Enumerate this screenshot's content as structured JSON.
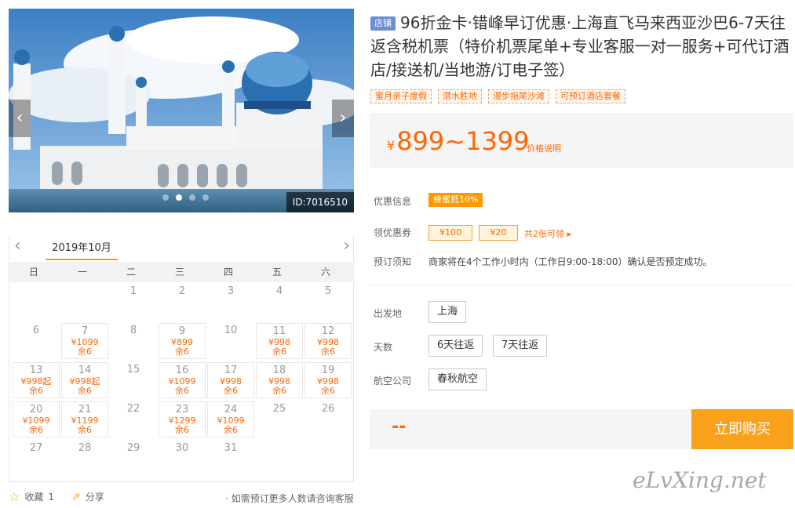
{
  "photo": {
    "id_label": "ID:7016510",
    "prev_icon": "chevron-left-icon",
    "next_icon": "chevron-right-icon",
    "dots": 4,
    "active_dot": 1
  },
  "calendar": {
    "month": "2019年10月",
    "prev": "‹",
    "next": "›",
    "weekdays": [
      "日",
      "一",
      "二",
      "三",
      "四",
      "五",
      "六"
    ],
    "days": [
      {
        "day": "1",
        "col": 2,
        "row": 0
      },
      {
        "day": "2",
        "col": 3,
        "row": 0
      },
      {
        "day": "3",
        "col": 4,
        "row": 0
      },
      {
        "day": "4",
        "col": 5,
        "row": 0
      },
      {
        "day": "5",
        "col": 6,
        "row": 0
      },
      {
        "day": "6",
        "col": 0,
        "row": 1
      },
      {
        "day": "7",
        "col": 1,
        "row": 1,
        "price": "¥1099",
        "rest": "余6"
      },
      {
        "day": "8",
        "col": 2,
        "row": 1
      },
      {
        "day": "9",
        "col": 3,
        "row": 1,
        "price": "¥899",
        "rest": "余6"
      },
      {
        "day": "10",
        "col": 4,
        "row": 1
      },
      {
        "day": "11",
        "col": 5,
        "row": 1,
        "price": "¥998",
        "rest": "余6"
      },
      {
        "day": "12",
        "col": 6,
        "row": 1,
        "price": "¥998",
        "rest": "余6"
      },
      {
        "day": "13",
        "col": 0,
        "row": 2,
        "price": "¥998起",
        "rest": "余6"
      },
      {
        "day": "14",
        "col": 1,
        "row": 2,
        "price": "¥998起",
        "rest": "余6"
      },
      {
        "day": "15",
        "col": 2,
        "row": 2
      },
      {
        "day": "16",
        "col": 3,
        "row": 2,
        "price": "¥1099",
        "rest": "余6"
      },
      {
        "day": "17",
        "col": 4,
        "row": 2,
        "price": "¥998",
        "rest": "余6"
      },
      {
        "day": "18",
        "col": 5,
        "row": 2,
        "price": "¥998",
        "rest": "余6"
      },
      {
        "day": "19",
        "col": 6,
        "row": 2,
        "price": "¥998",
        "rest": "余6"
      },
      {
        "day": "20",
        "col": 0,
        "row": 3,
        "price": "¥1099",
        "rest": "余6"
      },
      {
        "day": "21",
        "col": 1,
        "row": 3,
        "price": "¥1199",
        "rest": "余6"
      },
      {
        "day": "22",
        "col": 2,
        "row": 3
      },
      {
        "day": "23",
        "col": 3,
        "row": 3,
        "price": "¥1299",
        "rest": "余6"
      },
      {
        "day": "24",
        "col": 4,
        "row": 3,
        "price": "¥1099",
        "rest": "余6"
      },
      {
        "day": "25",
        "col": 5,
        "row": 3
      },
      {
        "day": "26",
        "col": 6,
        "row": 3
      },
      {
        "day": "27",
        "col": 0,
        "row": 4
      },
      {
        "day": "28",
        "col": 1,
        "row": 4
      },
      {
        "day": "29",
        "col": 2,
        "row": 4
      },
      {
        "day": "30",
        "col": 3,
        "row": 4
      },
      {
        "day": "31",
        "col": 4,
        "row": 4
      }
    ]
  },
  "footer": {
    "fav_label": "收藏",
    "fav_count": "1",
    "share_label": "分享",
    "note": "· 如需预订更多人数请咨询客服"
  },
  "product": {
    "shop_badge": "店铺",
    "title": "96折金卡·错峰早订优惠·上海直飞马来西亚沙巴6-7天往返含税机票（特价机票尾单+专业客服一对一服务+可代订酒店/接送机/当地游/订电子签）",
    "tags": [
      "蜜月亲子度假",
      "潜水胜地",
      "漫步拖尾沙滩",
      "可预订酒店套餐"
    ],
    "price_currency": "¥",
    "price_range": "899~1399",
    "price_note": "价格说明"
  },
  "info": {
    "discount_label": "优惠信息",
    "discount_value": "蜂蜜抵10%",
    "coupon_label": "领优惠券",
    "coupons": [
      "¥100",
      "¥20"
    ],
    "coupon_more": "共2张可领 ▸",
    "notice_label": "预订须知",
    "notice_text": "商家将在4个工作小时内（工作日9:00-18:00）确认是否预定成功。"
  },
  "options": {
    "departure_label": "出发地",
    "departure": "上海",
    "days_label": "天数",
    "days": [
      "6天往返",
      "7天往返"
    ],
    "airline_label": "航空公司",
    "airline": "春秋航空"
  },
  "buy": {
    "total": "--",
    "button": "立即购买"
  },
  "watermark": "eLvXing.net",
  "colors": {
    "accent": "#ff6600",
    "button": "#f9a11b",
    "badge": "#6b8fcf"
  }
}
